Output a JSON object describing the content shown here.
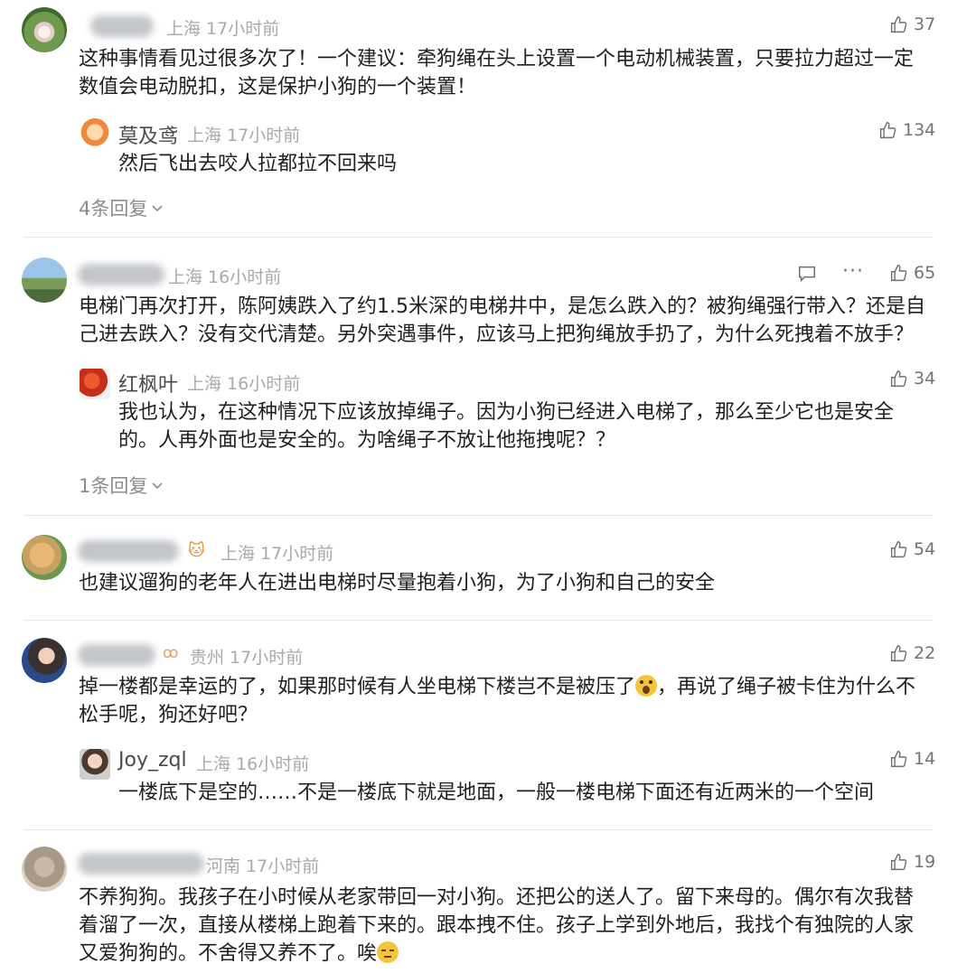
{
  "comments": [
    {
      "location": "上海 17小时前",
      "likes": "37",
      "text_lines": [
        "这种事情看见过很多次了！一个建议：牵狗绳在头上设置一个电动机械装置，只要拉力超过一定",
        "数值会电动脱扣，这是保护小狗的一个装置！"
      ],
      "reply": {
        "name": "莫及鸢",
        "meta": "上海 17小时前",
        "likes": "134",
        "text": "然后飞出去咬人拉都拉不回来吗"
      },
      "more": "4条回复"
    },
    {
      "location": "上海 16小时前",
      "likes": "65",
      "text_lines": [
        "电梯门再次打开，陈阿姨跌入了约1.5米深的电梯井中，是怎么跌入的？被狗绳强行带入？还是自",
        "己进去跌入？没有交代清楚。另外突遇事件，应该马上把狗绳放手扔了，为什么死拽着不放手？"
      ],
      "reply": {
        "name": "红枫叶",
        "meta": "上海 16小时前",
        "likes": "34",
        "text_lines": [
          "我也认为，在这种情况下应该放掉绳子。因为小狗已经进入电梯了，那么至少它也是安全",
          "的。人再外面也是安全的。为啥绳子不放让他拖拽呢？？"
        ]
      },
      "more": "1条回复"
    },
    {
      "location": "上海 17小时前",
      "likes": "54",
      "text_lines": [
        "也建议遛狗的老年人在进出电梯时尽量抱着小狗，为了小狗和自己的安全"
      ]
    },
    {
      "location": "贵州 17小时前",
      "likes": "22",
      "text_lines_a": "掉一楼都是幸运的了，如果那时候有人坐电梯下楼岂不是被压了",
      "text_lines_b": "，再说了绳子被卡住为什么不",
      "text_line2": "松手呢，狗还好吧？",
      "reply": {
        "name": "Joy_zql",
        "meta": "上海 16小时前",
        "likes": "14",
        "text": "一楼底下是空的……不是一楼底下就是地面，一般一楼电梯下面还有近两米的一个空间"
      }
    },
    {
      "location": "河南 17小时前",
      "likes": "19",
      "text_lines": [
        "不养狗狗。我孩子在小时候从老家带回一对小狗。还把公的送人了。留下来母的。偶尔有次我替",
        "着溜了一次，直接从楼梯上跑着下来的。跟本拽不住。孩子上学到外地后，我找个有独院的人家"
      ],
      "text_last": "又爱狗狗的。不舍得又养不了。唉"
    }
  ],
  "icons": {
    "like": "thumbs-up-icon",
    "reply": "comment-icon",
    "more": "ellipsis-icon",
    "chevron": "chevron-down-icon"
  }
}
